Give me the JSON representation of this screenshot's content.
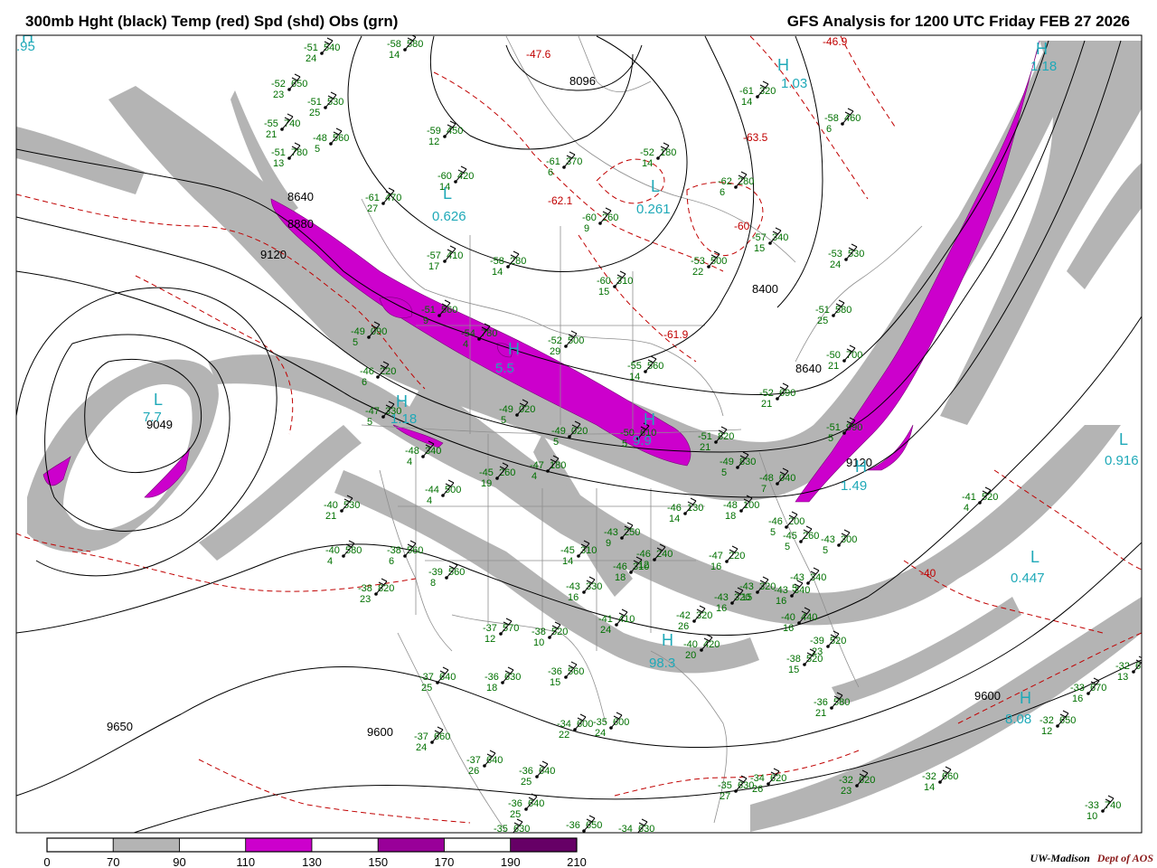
{
  "header": {
    "title": "300mb Hght (black) Temp (red) Spd (shd) Obs (grn)",
    "valid": "GFS Analysis for 1200 UTC Friday  FEB 27 2026"
  },
  "colors": {
    "height_contour": "#000000",
    "temperature_contour": "#c00000",
    "obs_text": "#007000",
    "hilo_text": "#1fa9b8",
    "speed_70_90": "#b4b4b4",
    "speed_110_130": "#cc00cc",
    "speed_150_170": "#990099",
    "speed_190_210": "#660066"
  },
  "legend": {
    "ticks": [
      "0",
      "70",
      "90",
      "110",
      "130",
      "150",
      "170",
      "190",
      "210"
    ],
    "fills": [
      "#ffffff",
      "#b4b4b4",
      "#ffffff",
      "#cc00cc",
      "#ffffff",
      "#990099",
      "#ffffff",
      "#660066"
    ]
  },
  "height_labels": [
    "9120",
    "8640",
    "8880",
    "9049",
    "8096",
    "8400",
    "8640",
    "9120",
    "9600",
    "9650",
    "9600"
  ],
  "hilo": [
    {
      "letter": "H",
      "value": "1.03"
    },
    {
      "letter": "L",
      "value": "0.626"
    },
    {
      "letter": "L",
      "value": "0.261"
    },
    {
      "letter": "H",
      "value": ".95"
    },
    {
      "letter": "L",
      "value": "7.7"
    },
    {
      "letter": "H",
      "value": "1.18"
    },
    {
      "letter": "H",
      "value": "5.5"
    },
    {
      "letter": "H",
      "value": "9.9"
    },
    {
      "letter": "H",
      "value": "1.49"
    },
    {
      "letter": "L",
      "value": "0.916"
    },
    {
      "letter": "L",
      "value": "0.447"
    },
    {
      "letter": "H",
      "value": "98.3"
    },
    {
      "letter": "H",
      "value": "8.08"
    },
    {
      "letter": "H",
      "value": "1.18"
    }
  ],
  "temp_labels": [
    "-47.6",
    "-46.9",
    "-63.5",
    "-62.1",
    "-60",
    "-61.9",
    "-40"
  ],
  "observations": [
    {
      "t": "-51",
      "z": "540",
      "d": "24"
    },
    {
      "t": "-58",
      "z": "580",
      "d": "14"
    },
    {
      "t": "-52",
      "z": "650",
      "d": "23"
    },
    {
      "t": "-51",
      "z": "530",
      "d": "25"
    },
    {
      "t": "-55",
      "z": "740",
      "d": "21"
    },
    {
      "t": "-48",
      "z": "560",
      "d": "5"
    },
    {
      "t": "-51",
      "z": "780",
      "d": "13"
    },
    {
      "t": "-59",
      "z": "450",
      "d": "12"
    },
    {
      "t": "-60",
      "z": "420",
      "d": "14"
    },
    {
      "t": "-61",
      "z": "370",
      "d": "6"
    },
    {
      "t": "-61",
      "z": "470",
      "d": "27"
    },
    {
      "t": "-60",
      "z": "260",
      "d": "9"
    },
    {
      "t": "-52",
      "z": "180",
      "d": "14"
    },
    {
      "t": "-62",
      "z": "280",
      "d": "6"
    },
    {
      "t": "-61",
      "z": "320",
      "d": "14"
    },
    {
      "t": "-58",
      "z": "460",
      "d": "6"
    },
    {
      "t": "-57",
      "z": "340",
      "d": "15"
    },
    {
      "t": "-53",
      "z": "530",
      "d": "24"
    },
    {
      "t": "-57",
      "z": "410",
      "d": "17"
    },
    {
      "t": "-58",
      "z": "280",
      "d": "14"
    },
    {
      "t": "-53",
      "z": "500",
      "d": "22"
    },
    {
      "t": "-60",
      "z": "310",
      "d": "15"
    },
    {
      "t": "-51",
      "z": "580",
      "d": "25"
    },
    {
      "t": "-51",
      "z": "560",
      "d": "9"
    },
    {
      "t": "-54",
      "z": "780",
      "d": "4"
    },
    {
      "t": "-52",
      "z": "500",
      "d": "29"
    },
    {
      "t": "-55",
      "z": "560",
      "d": "14"
    },
    {
      "t": "-50",
      "z": "700",
      "d": "21"
    },
    {
      "t": "-52",
      "z": "690",
      "d": "21"
    },
    {
      "t": "-51",
      "z": "820",
      "d": "21"
    },
    {
      "t": "-51",
      "z": "990",
      "d": "5"
    },
    {
      "t": "-49",
      "z": "090",
      "d": "5"
    },
    {
      "t": "-46",
      "z": "220",
      "d": "6"
    },
    {
      "t": "-47",
      "z": "330",
      "d": "5"
    },
    {
      "t": "-48",
      "z": "340",
      "d": "4"
    },
    {
      "t": "-49",
      "z": "020",
      "d": "5"
    },
    {
      "t": "-49",
      "z": "020",
      "d": "5"
    },
    {
      "t": "-50",
      "z": "610",
      "d": "5"
    },
    {
      "t": "-45",
      "z": "260",
      "d": "19"
    },
    {
      "t": "-47",
      "z": "180",
      "d": "4"
    },
    {
      "t": "-49",
      "z": "830",
      "d": "5"
    },
    {
      "t": "-48",
      "z": "100",
      "d": "18"
    },
    {
      "t": "-46",
      "z": "130",
      "d": "14"
    },
    {
      "t": "-48",
      "z": "040",
      "d": "7"
    },
    {
      "t": "-46",
      "z": "200",
      "d": "5"
    },
    {
      "t": "-45",
      "z": "260",
      "d": "5"
    },
    {
      "t": "-43",
      "z": "300",
      "d": "5"
    },
    {
      "t": "-41",
      "z": "520",
      "d": "4"
    },
    {
      "t": "-43",
      "z": "340",
      "d": "5"
    },
    {
      "t": "-44",
      "z": "500",
      "d": "4"
    },
    {
      "t": "-40",
      "z": "530",
      "d": "21"
    },
    {
      "t": "-40",
      "z": "580",
      "d": "4"
    },
    {
      "t": "-38",
      "z": "560",
      "d": "6"
    },
    {
      "t": "-39",
      "z": "560",
      "d": "8"
    },
    {
      "t": "-45",
      "z": "310",
      "d": "14"
    },
    {
      "t": "-46",
      "z": "310",
      "d": "18"
    },
    {
      "t": "-43",
      "z": "330",
      "d": "16"
    },
    {
      "t": "-43",
      "z": "250",
      "d": "9"
    },
    {
      "t": "-46",
      "z": "240",
      "d": "12"
    },
    {
      "t": "-47",
      "z": "220",
      "d": "16"
    },
    {
      "t": "-43",
      "z": "320",
      "d": "16"
    },
    {
      "t": "-43",
      "z": "320",
      "d": "15"
    },
    {
      "t": "-43",
      "z": "340",
      "d": "16"
    },
    {
      "t": "-40",
      "z": "440",
      "d": "16"
    },
    {
      "t": "-42",
      "z": "320",
      "d": "26"
    },
    {
      "t": "-41",
      "z": "410",
      "d": "24"
    },
    {
      "t": "-40",
      "z": "420",
      "d": "20"
    },
    {
      "t": "-39",
      "z": "520",
      "d": "23"
    },
    {
      "t": "-38",
      "z": "520",
      "d": "15"
    },
    {
      "t": "-36",
      "z": "580",
      "d": "21"
    },
    {
      "t": "-37",
      "z": "570",
      "d": "12"
    },
    {
      "t": "-38",
      "z": "520",
      "d": "10"
    },
    {
      "t": "-38",
      "z": "820",
      "d": "23"
    },
    {
      "t": "-36",
      "z": "560",
      "d": "15"
    },
    {
      "t": "-36",
      "z": "630",
      "d": "18"
    },
    {
      "t": "-37",
      "z": "640",
      "d": "25"
    },
    {
      "t": "-37",
      "z": "660",
      "d": "24"
    },
    {
      "t": "-34",
      "z": "600",
      "d": "22"
    },
    {
      "t": "-35",
      "z": "600",
      "d": "24"
    },
    {
      "t": "-37",
      "z": "640",
      "d": "26"
    },
    {
      "t": "-36",
      "z": "640",
      "d": "25"
    },
    {
      "t": "-36",
      "z": "640",
      "d": "25"
    },
    {
      "t": "-35",
      "z": "630",
      "d": "27"
    },
    {
      "t": "-34",
      "z": "620",
      "d": "26"
    },
    {
      "t": "-35",
      "z": "630",
      "d": ""
    },
    {
      "t": "-36",
      "z": "650",
      "d": ""
    },
    {
      "t": "-34",
      "z": "630",
      "d": ""
    },
    {
      "t": "-32",
      "z": "620",
      "d": "23"
    },
    {
      "t": "-32",
      "z": "660",
      "d": "14"
    },
    {
      "t": "-33",
      "z": "670",
      "d": "16"
    },
    {
      "t": "-32",
      "z": "650",
      "d": "12"
    },
    {
      "t": "-33",
      "z": "740",
      "d": "10"
    },
    {
      "t": "-32",
      "z": "640",
      "d": "13"
    }
  ],
  "credit": {
    "org": "UW-Madison",
    "dept": "Dept of AOS"
  }
}
